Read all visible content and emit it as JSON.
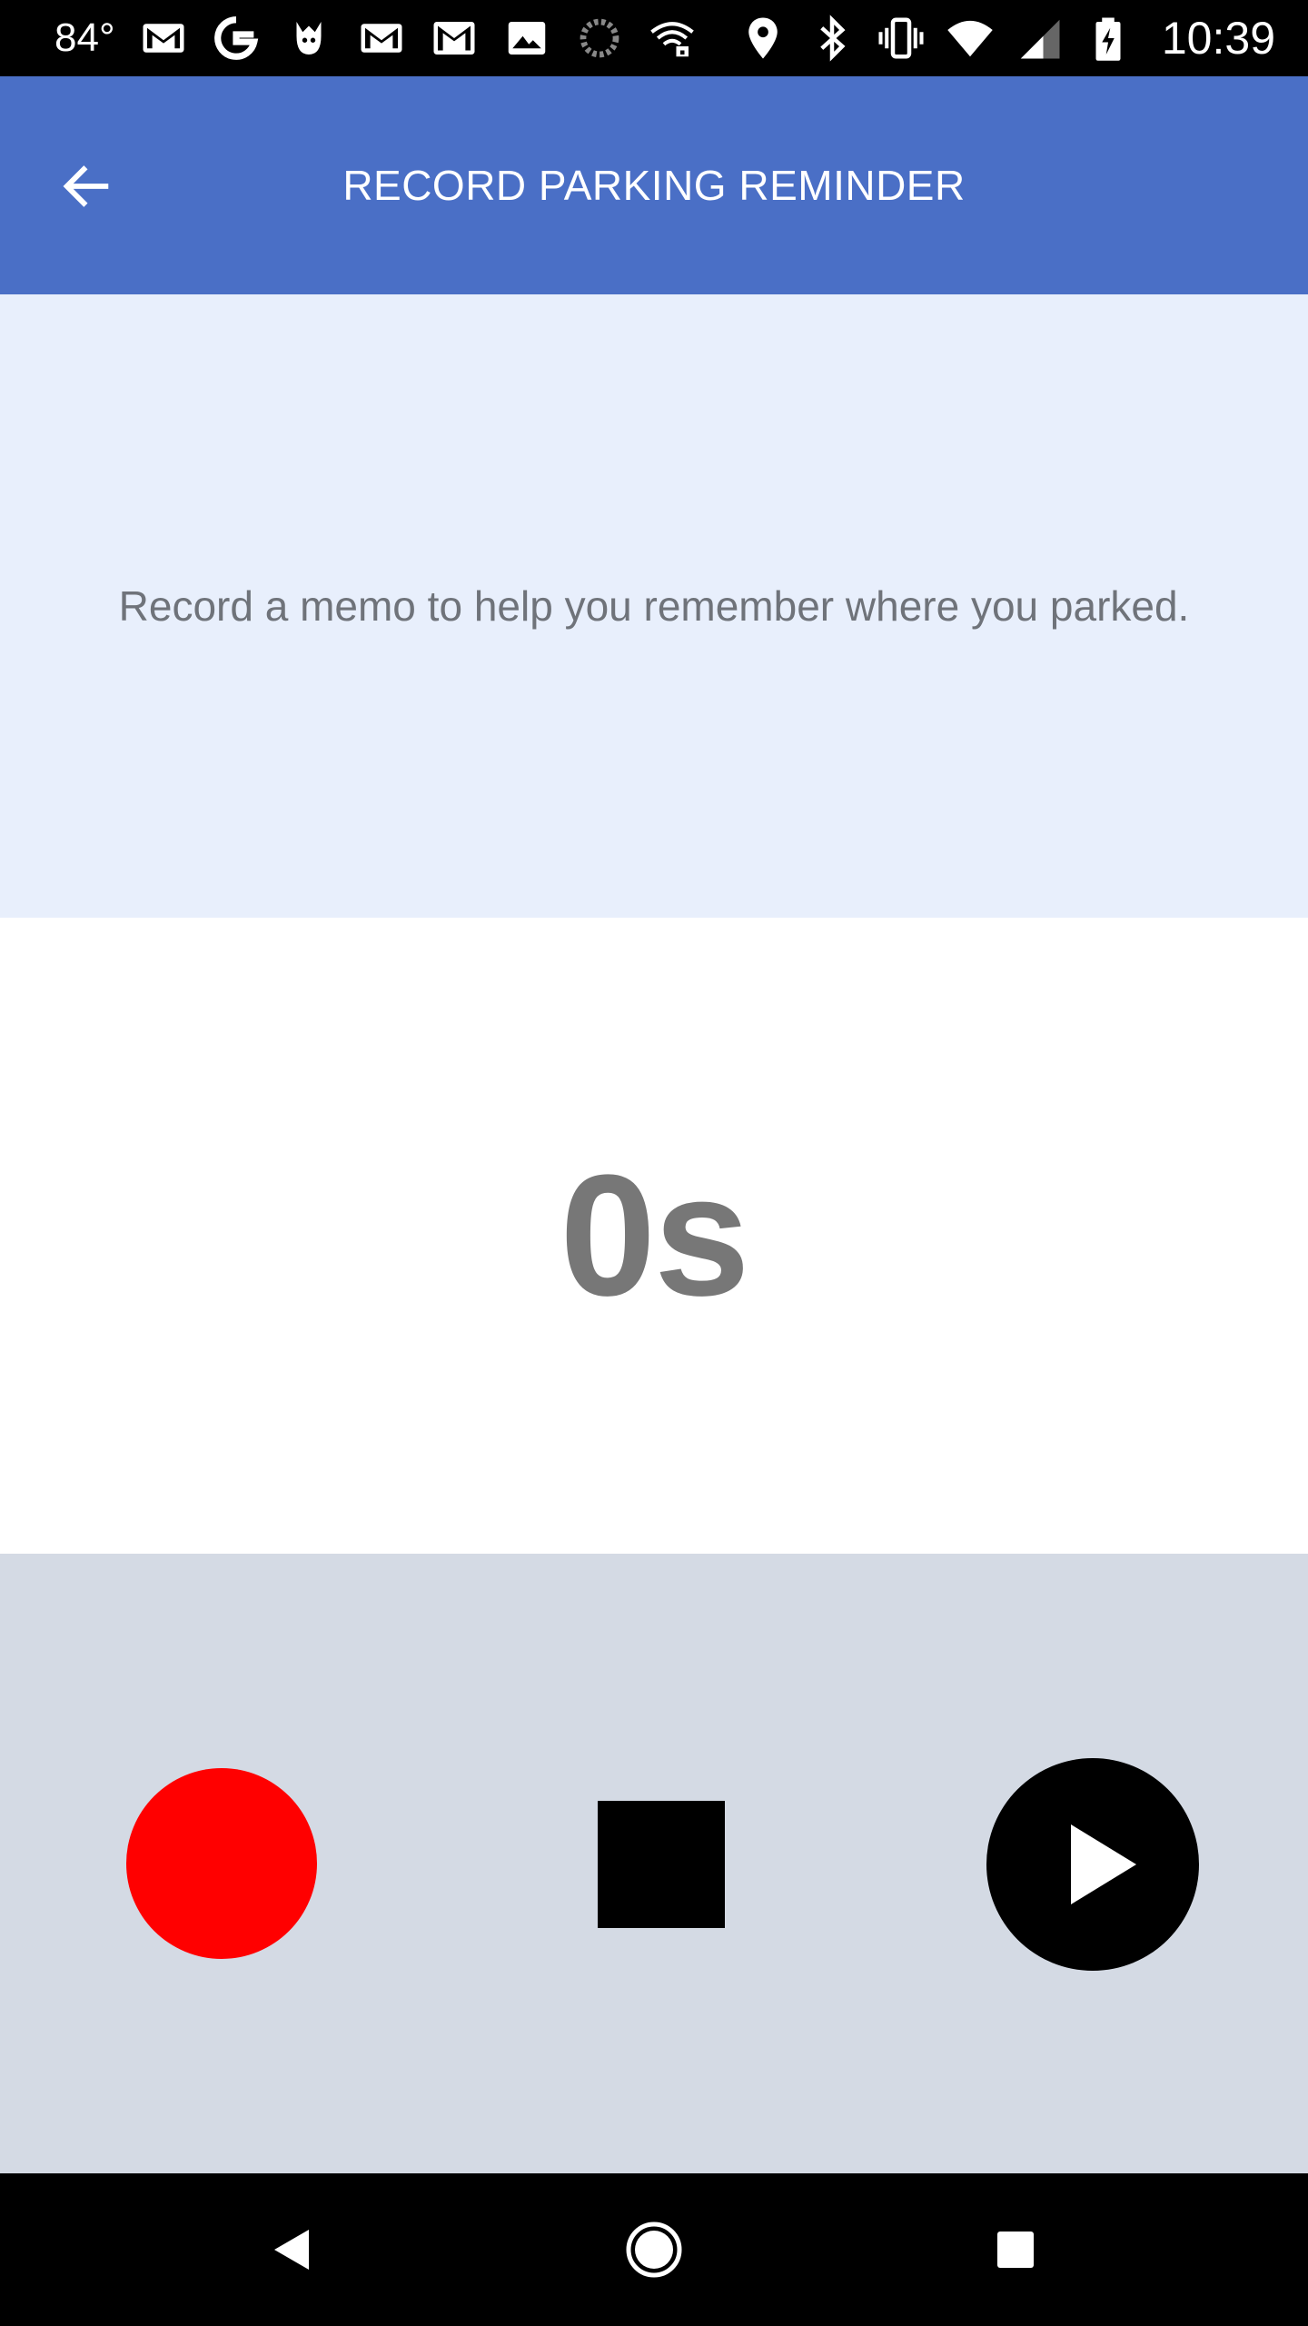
{
  "status_bar": {
    "temperature": "84°",
    "time": "10:39",
    "left_icons": [
      "gmail-icon",
      "google-icon",
      "pokemon-go-icon",
      "gmail-icon",
      "gmail-icon",
      "gallery-icon",
      "sync-icon",
      "wifi-lock-icon"
    ],
    "right_icons": [
      "location-icon",
      "bluetooth-icon",
      "vibrate-icon",
      "wifi-icon",
      "cellular-signal-icon",
      "battery-charging-icon"
    ]
  },
  "app_bar": {
    "title": "RECORD PARKING REMINDER",
    "back_icon": "arrow-back-icon",
    "color": "#4a6fc6"
  },
  "info_panel": {
    "text": "Record a memo to help you remember where you parked.",
    "background": "#e8effc"
  },
  "timer": {
    "value": "0s"
  },
  "controls": {
    "record_icon": "record-icon",
    "stop_icon": "stop-icon",
    "play_icon": "play-icon",
    "record_color": "#ff0000",
    "background": "#d4dae4"
  },
  "nav_bar": {
    "icons": [
      "nav-back-icon",
      "nav-home-icon",
      "nav-recent-apps-icon"
    ]
  }
}
